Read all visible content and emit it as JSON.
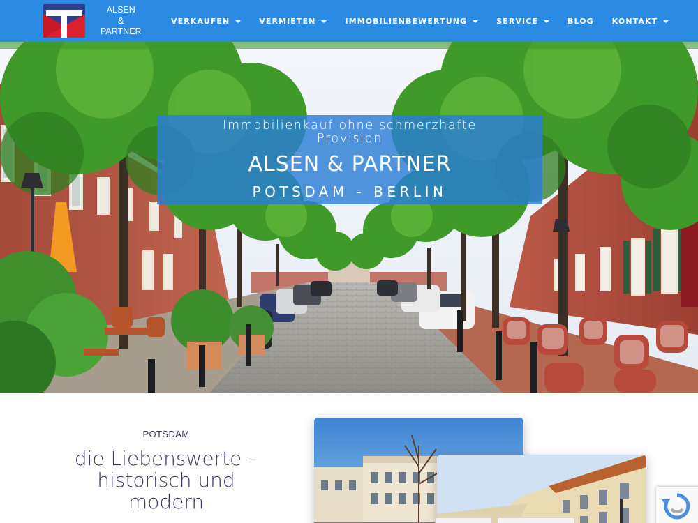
{
  "brand": {
    "name_line1": "ALSEN",
    "name_line2": "&",
    "name_line3": "PARTNER",
    "colors": {
      "logo_blue": "#2e3f8f",
      "logo_red": "#d21b2a",
      "nav_blue": "#2b8be3"
    }
  },
  "nav": {
    "items": [
      {
        "label": "VERKAUFEN",
        "has_dropdown": true
      },
      {
        "label": "VERMIETEN",
        "has_dropdown": true
      },
      {
        "label": "IMMOBILIENBEWERTUNG",
        "has_dropdown": true
      },
      {
        "label": "SERVICE",
        "has_dropdown": true
      },
      {
        "label": "BLOG",
        "has_dropdown": false
      },
      {
        "label": "KONTAKT",
        "has_dropdown": true
      }
    ]
  },
  "hero": {
    "tagline": "Immobilienkauf ohne schmerzhafte Provision",
    "title": "ALSEN & PARTNER",
    "subtitle": "POTSDAM - BERLIN"
  },
  "section": {
    "city": "POTSDAM",
    "headline_line1": "die Liebenswerte –",
    "headline_line2": "historisch und",
    "headline_line3": "modern"
  }
}
